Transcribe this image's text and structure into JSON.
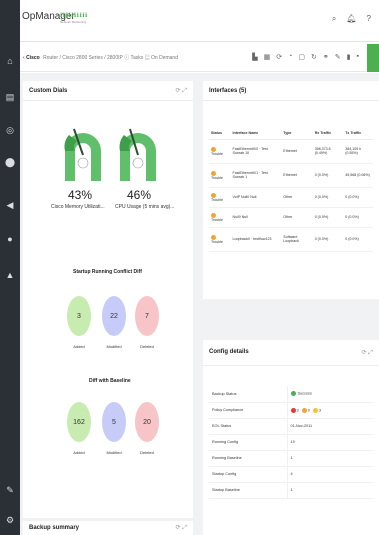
{
  "app": {
    "brand": "OpManager",
    "tag": "ℹℹℹℹℹℹℹℹℹℹ",
    "sub": "Network Monitoring"
  },
  "breadcrumb": {
    "device": "Cisco",
    "details": "Router / Cisco 2800 Series / 2800IP",
    "tasks": "Tasks",
    "on_demand": "On Demand"
  },
  "custom_dials": {
    "title": "Custom Dials",
    "gauges": [
      {
        "value": "43%",
        "caption": "Cisco Memory Utilizati...",
        "level": 0.43
      },
      {
        "value": "46%",
        "caption": "CPU Usage (5 mins avg)...",
        "level": 0.46
      }
    ],
    "startup_running": {
      "title": "Startup Running Conflict Diff",
      "items": [
        {
          "value": "3",
          "label": "Added"
        },
        {
          "value": "22",
          "label": "Modified"
        },
        {
          "value": "7",
          "label": "Deleted"
        }
      ]
    },
    "baseline": {
      "title": "Diff with Baseline",
      "items": [
        {
          "value": "162",
          "label": "Added"
        },
        {
          "value": "5",
          "label": "Modified"
        },
        {
          "value": "20",
          "label": "Deleted"
        }
      ]
    }
  },
  "interfaces": {
    "title": "Interfaces (5)",
    "columns": [
      "Status",
      "Interface Name",
      "Type",
      "Rx Traffic",
      "Tx Traffic"
    ],
    "rows": [
      {
        "status": "Trouble",
        "name": "FastEthernet0/0 · Test Sunrab 10",
        "type": "Ethernet",
        "rx": "398,373.6 (0.49%)",
        "tx": "384,109 k (0.55%)"
      },
      {
        "status": "Trouble",
        "name": "FastEthernet0/1 · Test Sunrab 1",
        "type": "Ethernet",
        "rx": "0 (0.0%)",
        "tx": "49,568 (0.08%)"
      },
      {
        "status": "Trouble",
        "name": "VoIP Null0 Null",
        "type": "Other",
        "rx": "0 (0.0%)",
        "tx": "0 (0.0%)"
      },
      {
        "status": "Trouble",
        "name": "Null0 Null",
        "type": "Other",
        "rx": "0 (0.0%)",
        "tx": "0 (0.0%)"
      },
      {
        "status": "Trouble",
        "name": "Loopback0 · testflow123",
        "type": "Software Loopback",
        "rx": "0 (0.0%)",
        "tx": "0 (0.0%)"
      }
    ]
  },
  "config_details": {
    "title": "Config details",
    "rows": [
      {
        "label": "Backup Status",
        "value": "Success"
      },
      {
        "label": "Policy Compliance",
        "value": "",
        "counts": [
          "3",
          "0",
          "3"
        ]
      },
      {
        "label": "EOL Status",
        "value": "01-Nov-2011"
      },
      {
        "label": "Running Config",
        "value": "19"
      },
      {
        "label": "Running Baseline",
        "value": "1"
      },
      {
        "label": "Startup Config",
        "value": "4"
      },
      {
        "label": "Startup Baseline",
        "value": "1"
      }
    ]
  },
  "backup_summary": {
    "title": "Backup summary"
  },
  "panel_controls": "⟳ ⤢",
  "colors": {
    "gauge": "#5fbf6a",
    "added": "#c8ebb0",
    "modified": "#c7cbf7",
    "deleted": "#f7c4c7",
    "sidebar": "#2b2f36",
    "accent": "#4caf50"
  },
  "icons": [
    "home-icon",
    "inventory-icon",
    "alarm-icon",
    "map-pin-icon",
    "tag-icon",
    "chat-icon",
    "user-icon",
    "tools-icon",
    "settings-icon",
    "search-icon",
    "bell-icon",
    "help-icon"
  ]
}
